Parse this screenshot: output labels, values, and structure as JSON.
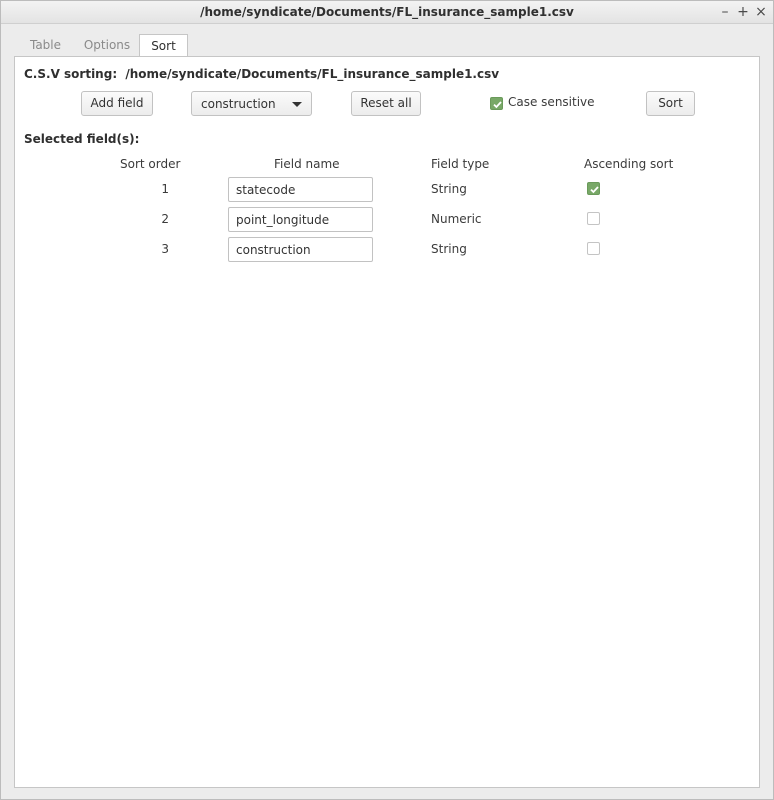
{
  "window": {
    "title": "/home/syndicate/Documents/FL_insurance_sample1.csv",
    "minimize_glyph": "–",
    "maximize_glyph": "+",
    "close_glyph": "×"
  },
  "tabs": [
    {
      "label": "Table"
    },
    {
      "label": "Options"
    },
    {
      "label": "Sort",
      "active": true
    }
  ],
  "sort_panel": {
    "csv_sorting_label": "C.S.V sorting:",
    "file_path": "/home/syndicate/Documents/FL_insurance_sample1.csv",
    "add_field_label": "Add field",
    "field_combo_value": "construction",
    "reset_all_label": "Reset all",
    "case_sensitive_label": "Case sensitive",
    "case_sensitive_checked": true,
    "sort_label": "Sort",
    "selected_fields_label": "Selected field(s):",
    "columns": {
      "sort_order": "Sort order",
      "field_name": "Field name",
      "field_type": "Field type",
      "ascending_sort": "Ascending sort"
    },
    "rows": [
      {
        "order": "1",
        "field_name": "statecode",
        "field_type": "String",
        "ascending": true
      },
      {
        "order": "2",
        "field_name": "point_longitude",
        "field_type": "Numeric",
        "ascending": false
      },
      {
        "order": "3",
        "field_name": "construction",
        "field_type": "String",
        "ascending": false
      }
    ]
  },
  "colors": {
    "check_accent": "#78a867"
  }
}
